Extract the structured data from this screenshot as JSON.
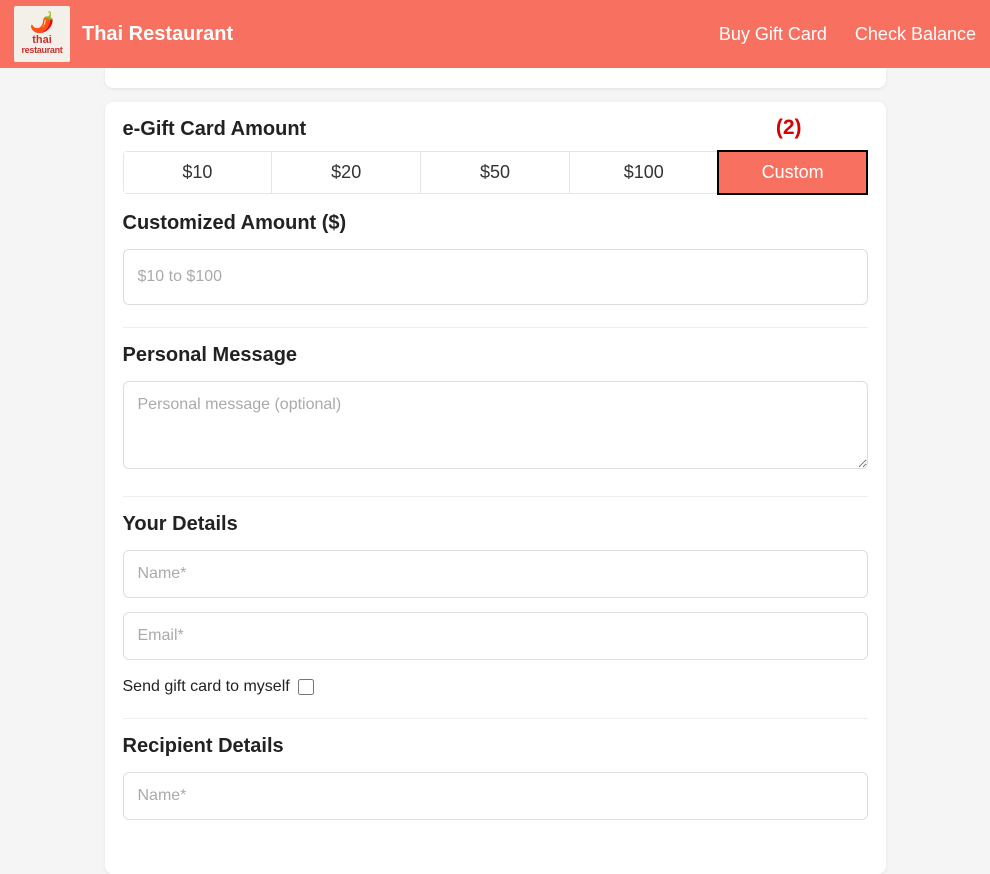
{
  "header": {
    "brand": "Thai Restaurant",
    "logo_line1": "thai",
    "logo_line2": "restaurant",
    "links": {
      "buy": "Buy Gift Card",
      "check": "Check Balance"
    }
  },
  "annotation": "(2)",
  "amount": {
    "title": "e-Gift Card Amount",
    "options": [
      "$10",
      "$20",
      "$50",
      "$100",
      "Custom"
    ],
    "selected_index": 4
  },
  "custom_amount": {
    "label": "Customized Amount ($)",
    "placeholder": "$10 to $100",
    "value": ""
  },
  "personal_message": {
    "label": "Personal Message",
    "placeholder": "Personal message (optional)",
    "value": ""
  },
  "your_details": {
    "title": "Your Details",
    "name_placeholder": "Name*",
    "name_value": "",
    "email_placeholder": "Email*",
    "email_value": "",
    "send_to_myself_label": "Send gift card to myself",
    "send_to_myself_checked": false
  },
  "recipient_details": {
    "title": "Recipient Details",
    "name_placeholder": "Name*",
    "name_value": ""
  }
}
